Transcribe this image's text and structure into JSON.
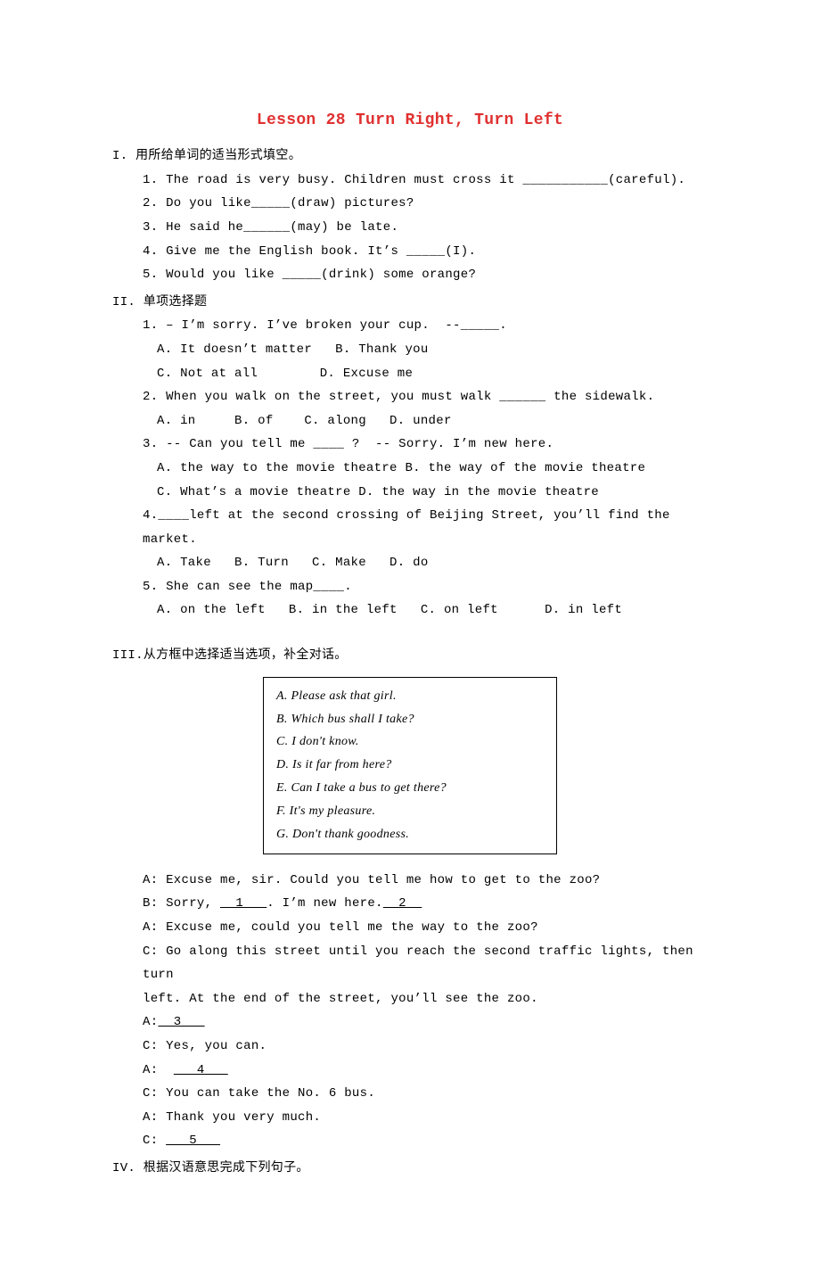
{
  "title": "Lesson 28 Turn Right, Turn Left",
  "sec1": {
    "heading": "I. 用所给单词的适当形式填空。",
    "q1": "1. The road is very busy. Children must cross it ___________(careful).",
    "q2": "2. Do you like_____(draw) pictures?",
    "q3": "3. He said he______(may) be late.",
    "q4": "4. Give me the English book. It’s _____(I).",
    "q5": "5. Would you like _____(drink) some orange?"
  },
  "sec2": {
    "heading": "II. 单项选择题",
    "q1": "1. – I’m sorry. I’ve broken your cup.  --_____.",
    "q1a": "A. It doesn’t matter   B. Thank you",
    "q1b": "C. Not at all        D. Excuse me",
    "q2": "2. When you walk on the street, you must walk ______ the sidewalk.",
    "q2a": "A. in     B. of    C. along   D. under",
    "q3": "3. -- Can you tell me ____ ?  -- Sorry. I’m new here.",
    "q3a": "A. the way to the movie theatre B. the way of the movie theatre",
    "q3b": "C. What’s a movie theatre D. the way in the movie theatre",
    "q4": "4.____left at the second crossing of Beijing Street, you’ll find the market.",
    "q4a": "A. Take   B. Turn   C. Make   D. do",
    "q5": "5. She can see the map____.",
    "q5a": "A. on the left   B. in the left   C. on left      D. in left"
  },
  "sec3": {
    "heading": "III.从方框中选择适当选项，补全对话。",
    "box": {
      "a": "A. Please ask that girl.",
      "b": "B. Which bus shall I take?",
      "c": "C. I don't know.",
      "d": "D. Is it far from here?",
      "e": "E. Can I take a bus to get there?",
      "f": "F. It's my pleasure.",
      "g": "G. Don't thank goodness."
    },
    "d1": "A: Excuse me, sir. Could you tell me how to get to the zoo?",
    "d2a": "B: Sorry, ",
    "d2blank": "  1   ",
    "d2b": ". I’m new here.",
    "d2blank2": "  2  ",
    "d3": "A: Excuse me, could you tell me the way to the zoo?",
    "d4": "C: Go along this street until you reach the second traffic lights, then turn",
    "d5": "left. At the end of the street, you’ll see the zoo.",
    "d6a": "A:",
    "d6blank": "  3   ",
    "d7": "C: Yes, you can.",
    "d8a": "A:  ",
    "d8blank": "   4   ",
    "d9": "C: You can take the No. 6 bus.",
    "d10": "A: Thank you very much.",
    "d11a": "C: ",
    "d11blank": "   5   "
  },
  "sec4": {
    "heading": "IV. 根据汉语意思完成下列句子。"
  }
}
